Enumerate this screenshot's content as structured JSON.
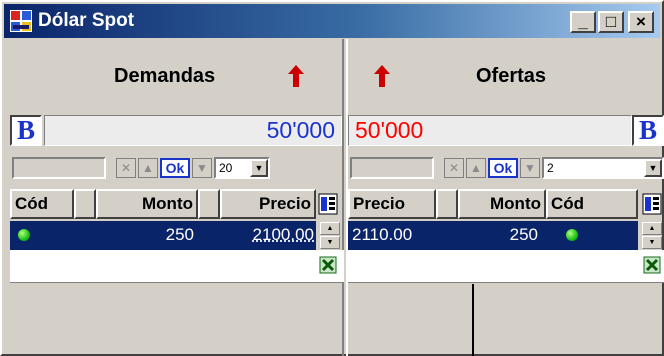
{
  "window": {
    "title": "Dólar Spot",
    "min_label": "_",
    "max_label": "□",
    "close_label": "×"
  },
  "colors": {
    "title_start": "#0a246a",
    "title_end": "#a6caf0",
    "bid_amount": "#1a33cc",
    "ask_amount": "#ff0000",
    "selection": "#0a246a",
    "arrow": "#cc0000"
  },
  "demandas": {
    "header": "Demandas",
    "arrow_icon": "up-arrow-icon",
    "b_label": "B",
    "amount": "50'000",
    "quantity_select": "20",
    "ok_label": "Ok",
    "columns": [
      "Cód",
      "Monto",
      "Precio"
    ],
    "row": {
      "monto": "250",
      "precio": "2100.00",
      "status": "green-dot"
    }
  },
  "ofertas": {
    "header": "Ofertas",
    "arrow_icon": "up-arrow-icon",
    "b_label": "B",
    "amount": "50'000",
    "quantity_select": "2",
    "ok_label": "Ok",
    "columns": [
      "Precio",
      "Monto",
      "Cód"
    ],
    "row": {
      "precio": "2110.00",
      "monto": "250",
      "status": "green-dot"
    }
  }
}
